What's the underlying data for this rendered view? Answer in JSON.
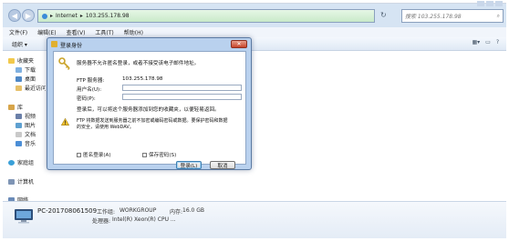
{
  "address_bar": {
    "path_1": "Internet",
    "path_2": "103.255.178.98"
  },
  "search": {
    "placeholder": "搜索 103.255.178.98"
  },
  "menu": [
    "文件(F)",
    "编辑(E)",
    "查看(V)",
    "工具(T)",
    "帮助(H)"
  ],
  "toolbar": {
    "organize": "组织 ▾"
  },
  "sidebar": {
    "favorites": "收藏夹",
    "downloads": "下载",
    "desktop": "桌面",
    "recent": "最近访问",
    "libraries": "库",
    "videos": "视频",
    "pictures": "图片",
    "documents": "文档",
    "music": "音乐",
    "homegroup": "家庭组",
    "computer": "计算机",
    "network": "网络"
  },
  "details": {
    "computer_name": "PC-201708061509",
    "domain_label": "工作组:",
    "domain_value": "WORKGROUP",
    "memory_label": "内存:",
    "memory_value": "16.0 GB",
    "processor_label": "处理器:",
    "processor_value": "Intel(R) Xeon(R) CPU ..."
  },
  "dialog": {
    "title": "登录身份",
    "close": "✕",
    "intro": "服务器不允许匿名登录，或者不接受该电子邮件地址。",
    "ftp_server_label": "FTP 服务器:",
    "ftp_server_value": "103.255.178.98",
    "username_label": "用户名(U):",
    "password_label": "密码(P):",
    "note": "登录后，可以将这个服务器添加到您的收藏夹，以便轻易返回。",
    "warning_line1": "FTP 将数据发送到服务器之前不加密或编码密码或数据。要保护密码和数据",
    "warning_line2": "的安全，请使用 WebDAV。",
    "anonymous_label": "匿名登录(A)",
    "save_password_label": "保存密码(S)",
    "login_button": "登录(L)",
    "cancel_button": "取消"
  }
}
